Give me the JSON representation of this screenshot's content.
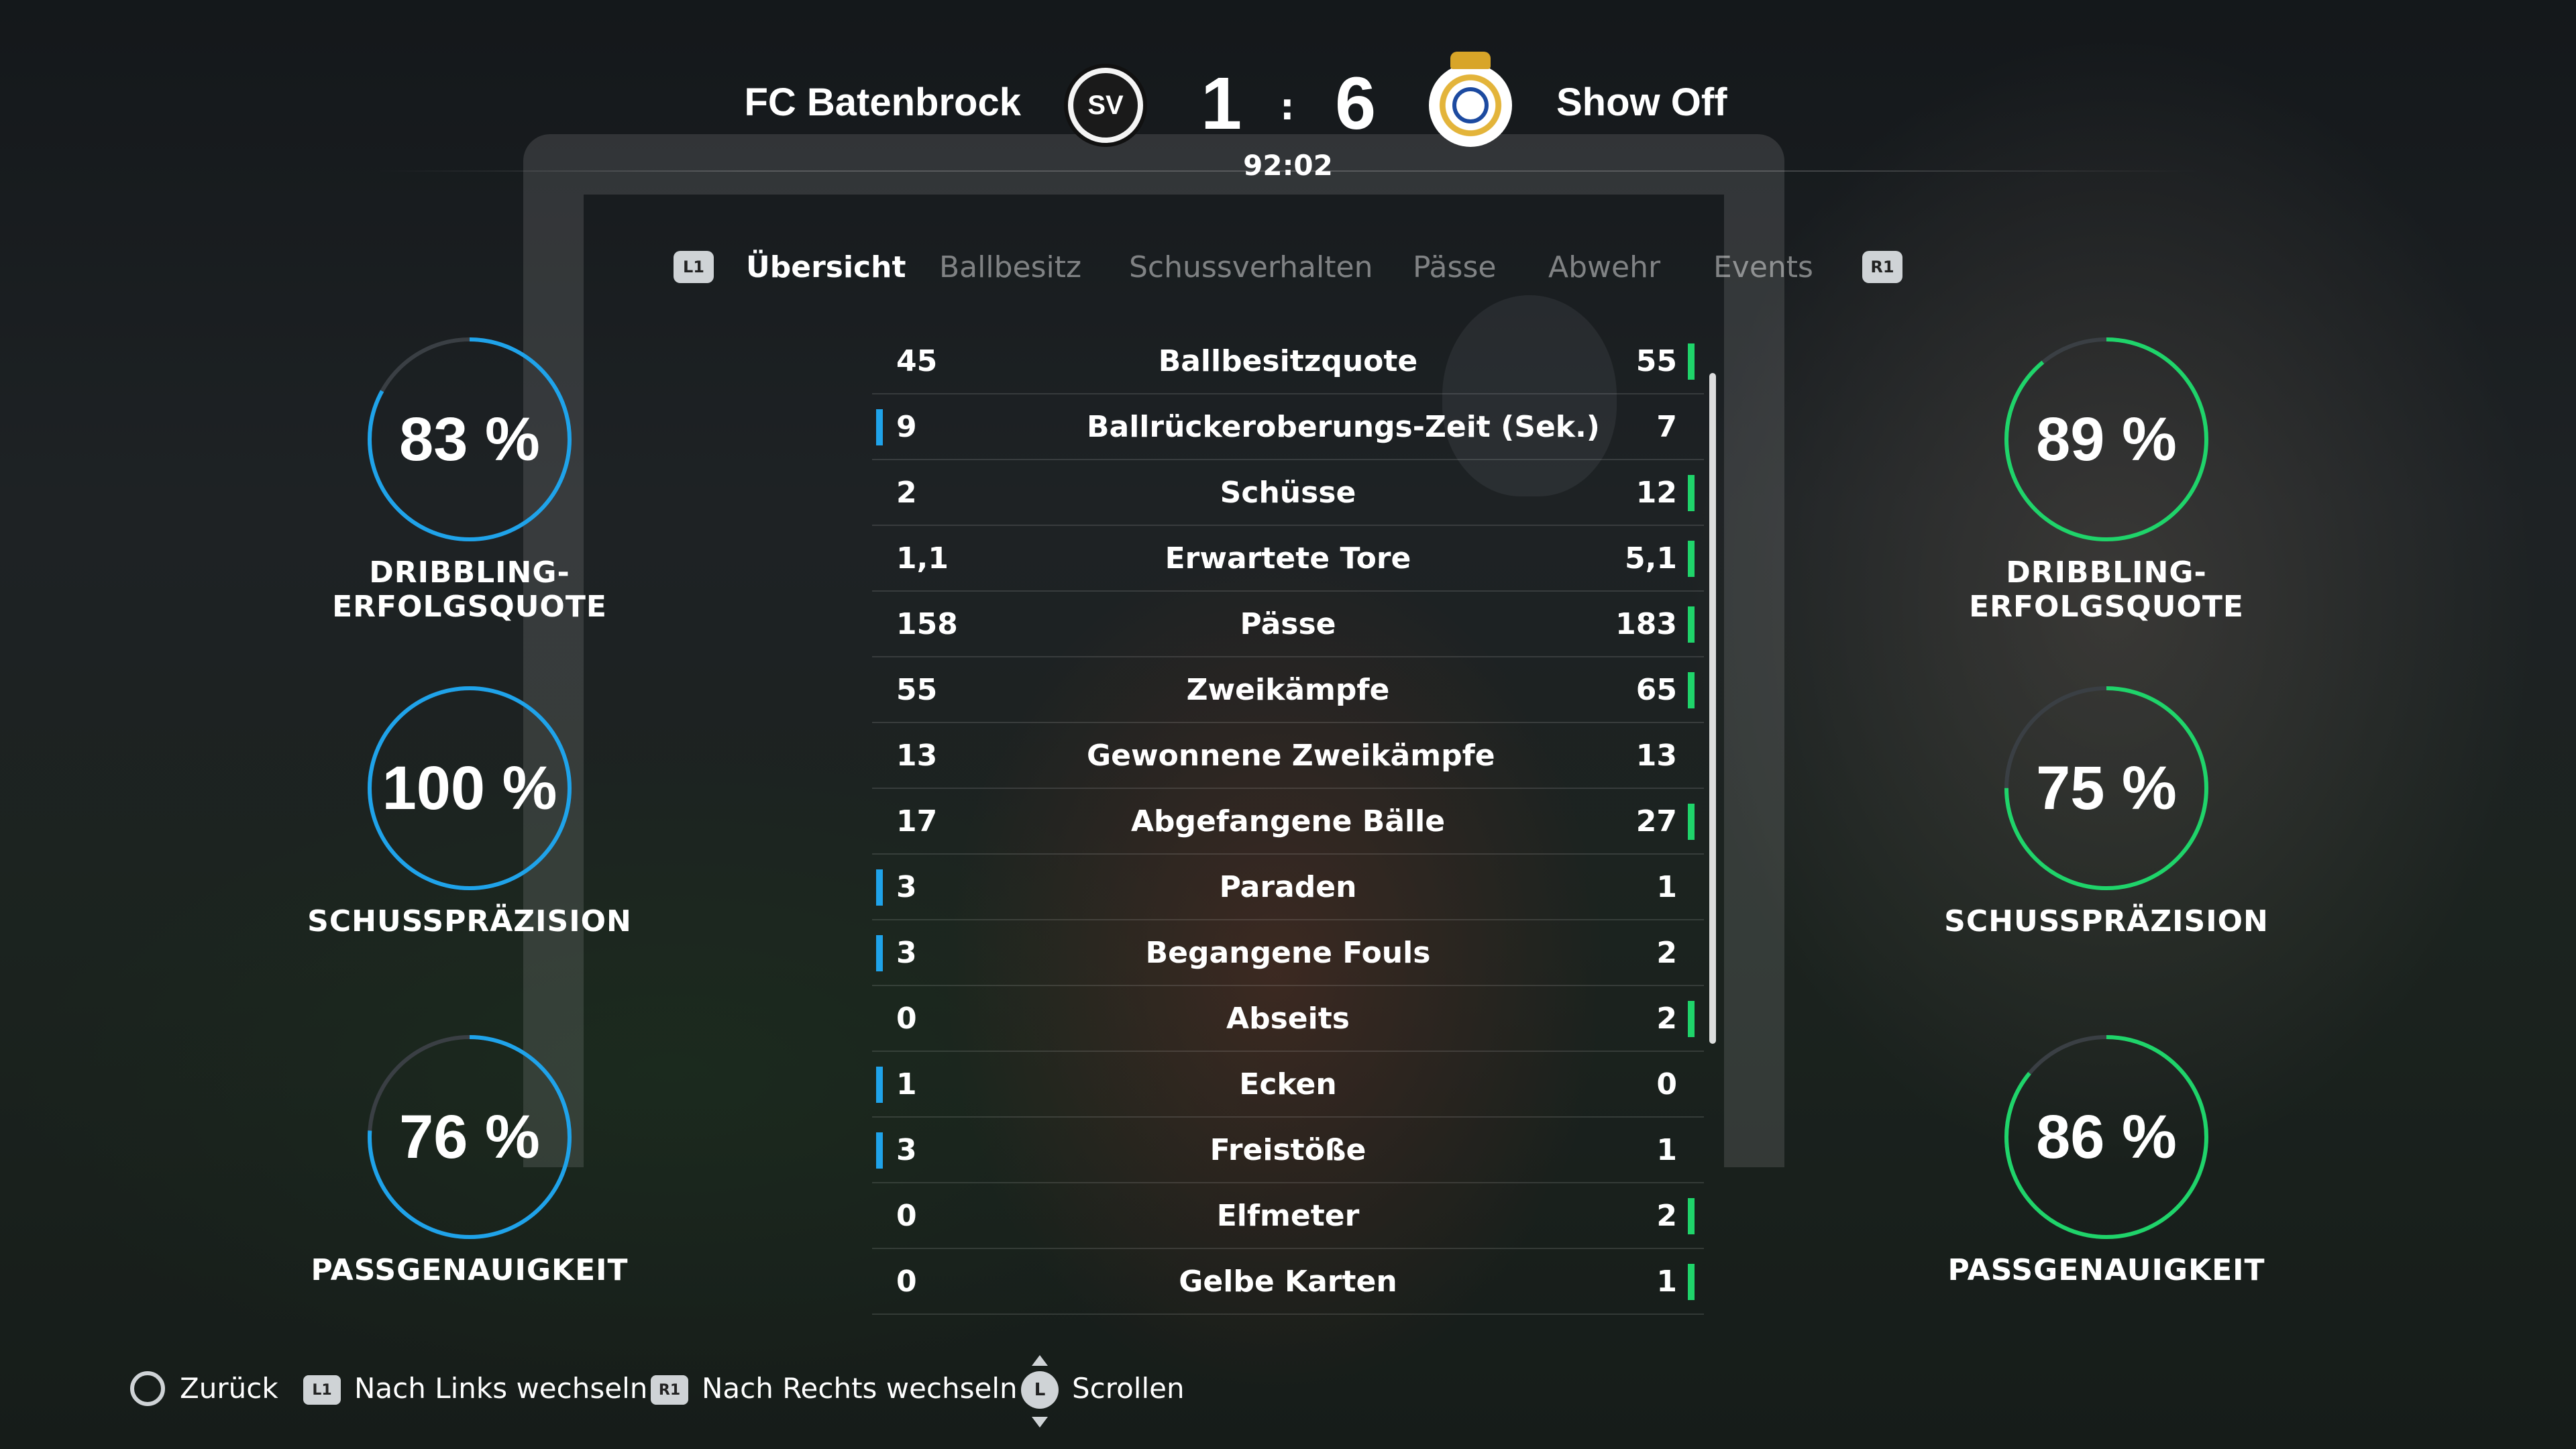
{
  "header": {
    "home_team": "FC Batenbrock",
    "away_team": "Show Off",
    "home_crest_text": "SV",
    "home_score": "1",
    "separator": ":",
    "away_score": "6",
    "match_time": "92:02"
  },
  "tabs": {
    "prev_button": "L1",
    "next_button": "R1",
    "items": [
      {
        "label": "Übersicht",
        "active": true
      },
      {
        "label": "Ballbesitz",
        "active": false
      },
      {
        "label": "Schussverhalten",
        "active": false
      },
      {
        "label": "Pässe",
        "active": false
      },
      {
        "label": "Abwehr",
        "active": false
      },
      {
        "label": "Events",
        "active": false
      }
    ]
  },
  "colors": {
    "home_accent": "#1fa3ea",
    "away_accent": "#1fd46a",
    "ring_track": "#3a3f44"
  },
  "home_rings": [
    {
      "value": "83 %",
      "percent": 83,
      "label": "DRIBBLING-ERFOLGSQUOTE"
    },
    {
      "value": "100 %",
      "percent": 100,
      "label": "SCHUSSPRÄZISION"
    },
    {
      "value": "76 %",
      "percent": 76,
      "label": "PASSGENAUIGKEIT"
    }
  ],
  "away_rings": [
    {
      "value": "89 %",
      "percent": 89,
      "label": "DRIBBLING-ERFOLGSQUOTE"
    },
    {
      "value": "75 %",
      "percent": 75,
      "label": "SCHUSSPRÄZISION"
    },
    {
      "value": "86 %",
      "percent": 86,
      "label": "PASSGENAUIGKEIT"
    }
  ],
  "stats": [
    {
      "name": "Ballbesitzquote",
      "home": "45",
      "away": "55",
      "leader": "away"
    },
    {
      "name": "Ballrückeroberungs-Zeit (Sek.)",
      "home": "9",
      "away": "7",
      "leader": "home"
    },
    {
      "name": "Schüsse",
      "home": "2",
      "away": "12",
      "leader": "away"
    },
    {
      "name": "Erwartete Tore",
      "home": "1,1",
      "away": "5,1",
      "leader": "away"
    },
    {
      "name": "Pässe",
      "home": "158",
      "away": "183",
      "leader": "away"
    },
    {
      "name": "Zweikämpfe",
      "home": "55",
      "away": "65",
      "leader": "away"
    },
    {
      "name": "Gewonnene Zweikämpfe",
      "home": "13",
      "away": "13",
      "leader": "none"
    },
    {
      "name": "Abgefangene Bälle",
      "home": "17",
      "away": "27",
      "leader": "away"
    },
    {
      "name": "Paraden",
      "home": "3",
      "away": "1",
      "leader": "home"
    },
    {
      "name": "Begangene Fouls",
      "home": "3",
      "away": "2",
      "leader": "home"
    },
    {
      "name": "Abseits",
      "home": "0",
      "away": "2",
      "leader": "away"
    },
    {
      "name": "Ecken",
      "home": "1",
      "away": "0",
      "leader": "home"
    },
    {
      "name": "Freistöße",
      "home": "3",
      "away": "1",
      "leader": "home"
    },
    {
      "name": "Elfmeter",
      "home": "0",
      "away": "2",
      "leader": "away"
    },
    {
      "name": "Gelbe Karten",
      "home": "0",
      "away": "1",
      "leader": "away"
    }
  ],
  "footer": {
    "back_label": "Zurück",
    "left_button": "L1",
    "left_label": "Nach Links wechseln",
    "right_button": "R1",
    "right_label": "Nach Rechts wechseln",
    "stick_button": "L",
    "scroll_label": "Scrollen"
  }
}
